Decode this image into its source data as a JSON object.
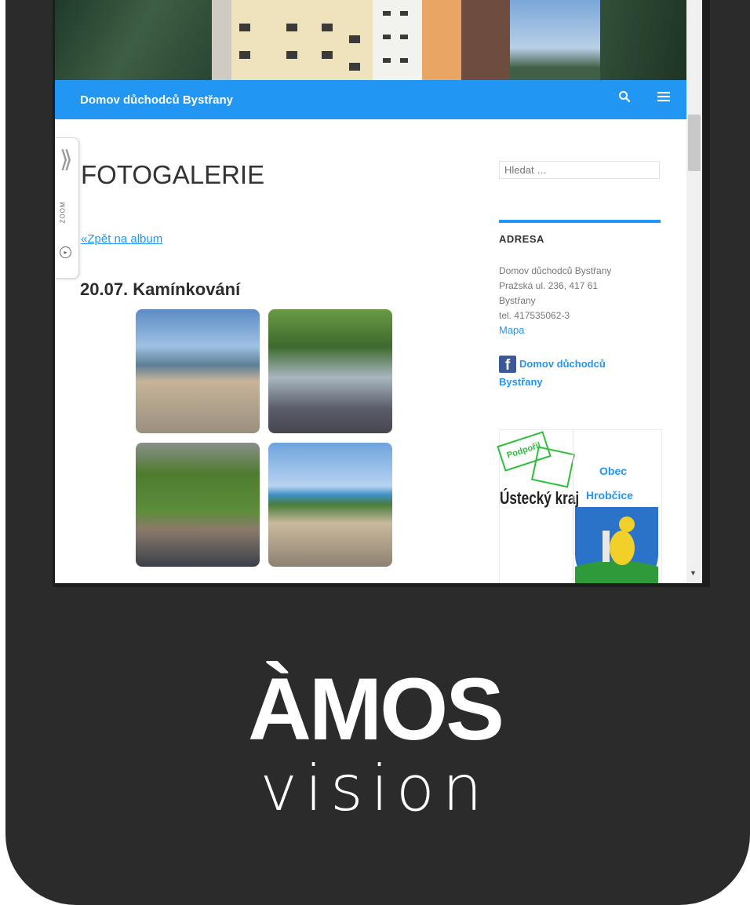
{
  "navbar": {
    "site_title": "Domov důchodců Bystřany"
  },
  "zoom_tab": {
    "label": "ZOOM"
  },
  "content": {
    "page_title": "FOTOGALERIE",
    "back_link": "«Zpět na album",
    "album_title": "20.07. Kamínkování"
  },
  "sidebar": {
    "search_placeholder": "Hledat …",
    "address_heading": "ADRESA",
    "address_lines": [
      "Domov důchodců Bystřany",
      "Pražská ul. 236, 417 61",
      "Bystřany",
      "tel. 417535062-3"
    ],
    "map_link": "Mapa",
    "facebook_line1": "Domov důchodců",
    "facebook_line2": "Bystřany",
    "banner": {
      "stamp_text": "Podpořil",
      "region_text": "Ústecký kraj",
      "obec_line1": "Obec",
      "obec_line2": "Hrobčice"
    }
  },
  "brand": {
    "name": "ÀMOS",
    "tagline": "vision"
  },
  "colors": {
    "accent": "#2196f3",
    "frame": "#2b2b2b",
    "facebook": "#3b5998",
    "stamp": "#2bbf3a"
  }
}
